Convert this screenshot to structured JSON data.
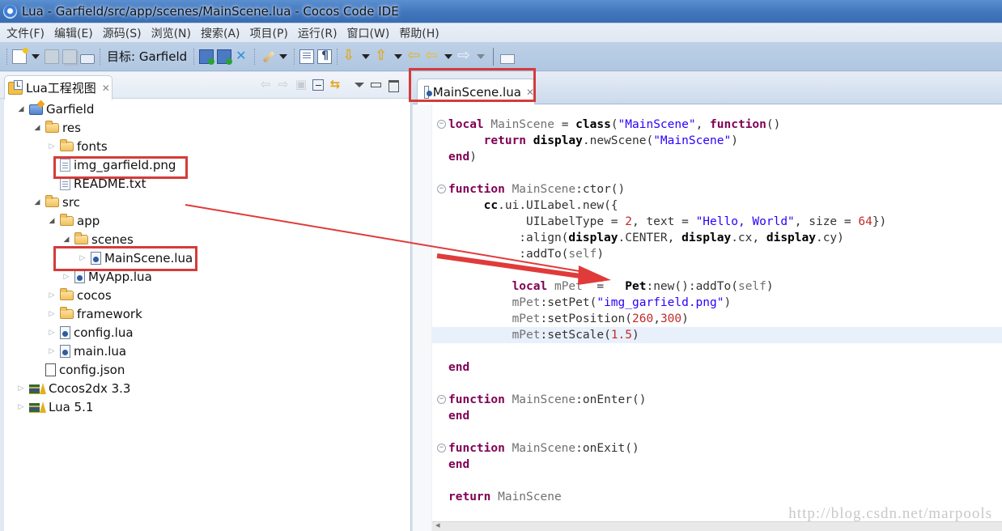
{
  "window": {
    "title": "Lua - Garfield/src/app/scenes/MainScene.lua - Cocos Code IDE"
  },
  "menu": [
    {
      "label": "文件(F)"
    },
    {
      "label": "编辑(E)"
    },
    {
      "label": "源码(S)"
    },
    {
      "label": "浏览(N)"
    },
    {
      "label": "搜索(A)"
    },
    {
      "label": "项目(P)"
    },
    {
      "label": "运行(R)"
    },
    {
      "label": "窗口(W)"
    },
    {
      "label": "帮助(H)"
    }
  ],
  "toolbar": {
    "target_label": "目标: Garfield",
    "icons": [
      "new-icon",
      "save-icon",
      "save-all-icon",
      "print-icon",
      "debug-icon",
      "run-icon",
      "remote-debug-icon",
      "brush-icon",
      "outline-icon",
      "paragraph-icon",
      "next-annotation-icon",
      "prev-annotation-icon",
      "last-edit-icon",
      "back-icon",
      "forward-icon",
      "window-icon"
    ]
  },
  "project_view": {
    "tab_label": "Lua工程视图",
    "tree": [
      {
        "label": "Garfield",
        "icon": "project-icon",
        "depth": 0,
        "expanded": true,
        "has_children": true
      },
      {
        "label": "res",
        "icon": "folder-icon",
        "depth": 1,
        "expanded": true,
        "has_children": true
      },
      {
        "label": "fonts",
        "icon": "folder-icon",
        "depth": 2,
        "expanded": false,
        "has_children": true
      },
      {
        "label": "img_garfield.png",
        "icon": "file-icon",
        "depth": 2,
        "has_children": false,
        "highlighted": true
      },
      {
        "label": "README.txt",
        "icon": "file-icon",
        "depth": 2,
        "has_children": false
      },
      {
        "label": "src",
        "icon": "folder-icon",
        "depth": 1,
        "expanded": true,
        "has_children": true
      },
      {
        "label": "app",
        "icon": "folder-icon",
        "depth": 2,
        "expanded": true,
        "has_children": true
      },
      {
        "label": "scenes",
        "icon": "folder-icon",
        "depth": 3,
        "expanded": true,
        "has_children": true
      },
      {
        "label": "MainScene.lua",
        "icon": "lua-file-icon",
        "depth": 4,
        "expanded": false,
        "has_children": true,
        "highlighted": true
      },
      {
        "label": "MyApp.lua",
        "icon": "lua-file-icon",
        "depth": 3,
        "expanded": false,
        "has_children": true
      },
      {
        "label": "cocos",
        "icon": "folder-icon",
        "depth": 2,
        "expanded": false,
        "has_children": true
      },
      {
        "label": "framework",
        "icon": "folder-icon",
        "depth": 2,
        "expanded": false,
        "has_children": true
      },
      {
        "label": "config.lua",
        "icon": "lua-file-icon",
        "depth": 2,
        "expanded": false,
        "has_children": true
      },
      {
        "label": "main.lua",
        "icon": "lua-file-icon",
        "depth": 2,
        "expanded": false,
        "has_children": true
      },
      {
        "label": "config.json",
        "icon": "blank-file-icon",
        "depth": 1,
        "has_children": false
      },
      {
        "label": "Cocos2dx 3.3",
        "icon": "library-icon",
        "depth": 0,
        "expanded": false,
        "has_children": true
      },
      {
        "label": "Lua 5.1",
        "icon": "library-icon",
        "depth": 0,
        "expanded": false,
        "has_children": true
      }
    ]
  },
  "editor": {
    "tab_label": "MainScene.lua",
    "current_line_index": 13,
    "lines": [
      {
        "fold": true,
        "tokens": [
          [
            "kw",
            "local"
          ],
          [
            "id",
            " MainScene "
          ],
          [
            "plain",
            "= "
          ],
          [
            "bold",
            "class"
          ],
          [
            "plain",
            "("
          ],
          [
            "str",
            "\"MainScene\""
          ],
          [
            "plain",
            ", "
          ],
          [
            "kw",
            "function"
          ],
          [
            "plain",
            "()"
          ]
        ]
      },
      {
        "tokens": [
          [
            "plain",
            "     "
          ],
          [
            "kw",
            "return"
          ],
          [
            "plain",
            " "
          ],
          [
            "bold",
            "display"
          ],
          [
            "plain",
            ".newScene("
          ],
          [
            "str",
            "\"MainScene\""
          ],
          [
            "plain",
            ")"
          ]
        ]
      },
      {
        "tokens": [
          [
            "kw",
            "end"
          ],
          [
            "plain",
            ")"
          ]
        ]
      },
      {
        "tokens": []
      },
      {
        "fold": true,
        "tokens": [
          [
            "kw",
            "function"
          ],
          [
            "id",
            " MainScene"
          ],
          [
            "plain",
            ":ctor()"
          ]
        ]
      },
      {
        "tokens": [
          [
            "plain",
            "     "
          ],
          [
            "bold",
            "cc"
          ],
          [
            "plain",
            ".ui.UILabel.new({"
          ]
        ]
      },
      {
        "tokens": [
          [
            "plain",
            "           UILabelType = "
          ],
          [
            "num",
            "2"
          ],
          [
            "plain",
            ", text = "
          ],
          [
            "str",
            "\"Hello, World\""
          ],
          [
            "plain",
            ", size = "
          ],
          [
            "num",
            "64"
          ],
          [
            "plain",
            "})"
          ]
        ]
      },
      {
        "tokens": [
          [
            "plain",
            "          :align("
          ],
          [
            "bold",
            "display"
          ],
          [
            "plain",
            ".CENTER, "
          ],
          [
            "bold",
            "display"
          ],
          [
            "plain",
            ".cx, "
          ],
          [
            "bold",
            "display"
          ],
          [
            "plain",
            ".cy)"
          ]
        ]
      },
      {
        "tokens": [
          [
            "plain",
            "          :addTo("
          ],
          [
            "id",
            "self"
          ],
          [
            "plain",
            ")"
          ]
        ]
      },
      {
        "tokens": []
      },
      {
        "tokens": [
          [
            "plain",
            "         "
          ],
          [
            "kw",
            "local"
          ],
          [
            "id",
            " mPet  "
          ],
          [
            "plain",
            "=   "
          ],
          [
            "bold",
            "Pet"
          ],
          [
            "plain",
            ":new():addTo("
          ],
          [
            "id",
            "self"
          ],
          [
            "plain",
            ")"
          ]
        ]
      },
      {
        "tokens": [
          [
            "id",
            "         mPet"
          ],
          [
            "plain",
            ":setPet("
          ],
          [
            "str",
            "\"img_garfield.png\""
          ],
          [
            "plain",
            ")"
          ]
        ]
      },
      {
        "tokens": [
          [
            "id",
            "         mPet"
          ],
          [
            "plain",
            ":setPosition("
          ],
          [
            "num",
            "260"
          ],
          [
            "plain",
            ","
          ],
          [
            "num",
            "300"
          ],
          [
            "plain",
            ")"
          ]
        ]
      },
      {
        "tokens": [
          [
            "id",
            "         mPet"
          ],
          [
            "plain",
            ":setScale("
          ],
          [
            "num",
            "1.5"
          ],
          [
            "plain",
            ")"
          ]
        ]
      },
      {
        "tokens": []
      },
      {
        "tokens": [
          [
            "kw",
            "end"
          ]
        ]
      },
      {
        "tokens": []
      },
      {
        "fold": true,
        "tokens": [
          [
            "kw",
            "function"
          ],
          [
            "id",
            " MainScene"
          ],
          [
            "plain",
            ":onEnter()"
          ]
        ]
      },
      {
        "tokens": [
          [
            "kw",
            "end"
          ]
        ]
      },
      {
        "tokens": []
      },
      {
        "fold": true,
        "tokens": [
          [
            "kw",
            "function"
          ],
          [
            "id",
            " MainScene"
          ],
          [
            "plain",
            ":onExit()"
          ]
        ]
      },
      {
        "tokens": [
          [
            "kw",
            "end"
          ]
        ]
      },
      {
        "tokens": []
      },
      {
        "tokens": [
          [
            "kw",
            "return"
          ],
          [
            "id",
            " MainScene"
          ]
        ]
      }
    ],
    "watermark": "http://blog.csdn.net/marpools"
  },
  "annotations": {
    "highlight_color": "#d63b3b",
    "arrow": {
      "from": "img_garfield.png reference in tree",
      "to": "local mPet line in editor"
    }
  }
}
